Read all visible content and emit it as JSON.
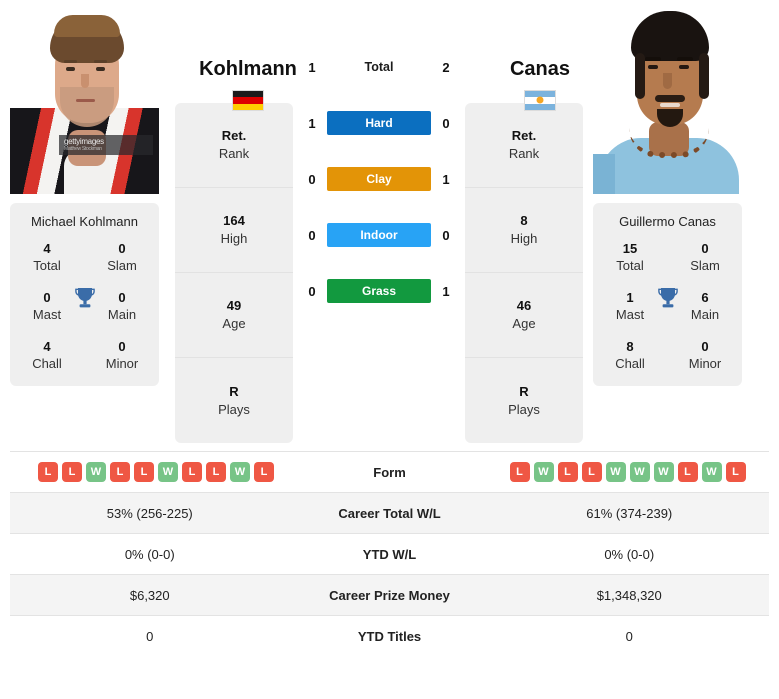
{
  "players": {
    "left": {
      "first_name": "Michael",
      "last_name": "Kohlmann",
      "full_name": "Michael Kohlmann",
      "flag": "germany-flag",
      "photo_watermark": "gettyimages",
      "photo_watermark_sub": "Matthew Stockman",
      "info": [
        {
          "value": "Ret.",
          "label": "Rank"
        },
        {
          "value": "164",
          "label": "High"
        },
        {
          "value": "49",
          "label": "Age"
        },
        {
          "value": "R",
          "label": "Plays"
        }
      ],
      "titles": [
        {
          "value": "4",
          "label": "Total"
        },
        {
          "value": "0",
          "label": "Slam"
        },
        {
          "value": "0",
          "label": "Mast"
        },
        {
          "value": "0",
          "label": "Main"
        },
        {
          "value": "4",
          "label": "Chall"
        },
        {
          "value": "0",
          "label": "Minor"
        }
      ],
      "form": [
        "L",
        "L",
        "W",
        "L",
        "L",
        "W",
        "L",
        "L",
        "W",
        "L"
      ],
      "career_total_wl": "53% (256-225)",
      "ytd_wl": "0% (0-0)",
      "career_prize_money": "$6,320",
      "ytd_titles": "0"
    },
    "right": {
      "first_name": "Guillermo",
      "last_name": "Canas",
      "full_name": "Guillermo Canas",
      "flag": "argentina-flag",
      "info": [
        {
          "value": "Ret.",
          "label": "Rank"
        },
        {
          "value": "8",
          "label": "High"
        },
        {
          "value": "46",
          "label": "Age"
        },
        {
          "value": "R",
          "label": "Plays"
        }
      ],
      "titles": [
        {
          "value": "15",
          "label": "Total"
        },
        {
          "value": "0",
          "label": "Slam"
        },
        {
          "value": "1",
          "label": "Mast"
        },
        {
          "value": "6",
          "label": "Main"
        },
        {
          "value": "8",
          "label": "Chall"
        },
        {
          "value": "0",
          "label": "Minor"
        }
      ],
      "form": [
        "L",
        "W",
        "L",
        "L",
        "W",
        "W",
        "W",
        "L",
        "W",
        "L"
      ],
      "career_total_wl": "61% (374-239)",
      "ytd_wl": "0% (0-0)",
      "career_prize_money": "$1,348,320",
      "ytd_titles": "0"
    }
  },
  "head_to_head": [
    {
      "label": "Total",
      "left": "1",
      "right": "2",
      "color": ""
    },
    {
      "label": "Hard",
      "left": "1",
      "right": "0",
      "color": "#0b6fc0"
    },
    {
      "label": "Clay",
      "left": "0",
      "right": "1",
      "color": "#e39407"
    },
    {
      "label": "Indoor",
      "left": "0",
      "right": "0",
      "color": "#28a3f5"
    },
    {
      "label": "Grass",
      "left": "0",
      "right": "1",
      "color": "#12993f"
    }
  ],
  "table": {
    "rows": [
      {
        "label": "Form",
        "left": "",
        "right": "",
        "type": "form"
      },
      {
        "label": "Career Total W/L",
        "left": "53% (256-225)",
        "right": "61% (374-239)",
        "type": "text"
      },
      {
        "label": "YTD W/L",
        "left": "0% (0-0)",
        "right": "0% (0-0)",
        "type": "text"
      },
      {
        "label": "Career Prize Money",
        "left": "$6,320",
        "right": "$1,348,320",
        "type": "text"
      },
      {
        "label": "YTD Titles",
        "left": "0",
        "right": "0",
        "type": "text"
      }
    ]
  },
  "colors": {
    "hard": "#0b6fc0",
    "clay": "#e39407",
    "indoor": "#28a3f5",
    "grass": "#12993f",
    "win": "#77c487",
    "loss": "#ef5744",
    "trophy": "#3a6ca8",
    "card_bg": "#efefef"
  }
}
